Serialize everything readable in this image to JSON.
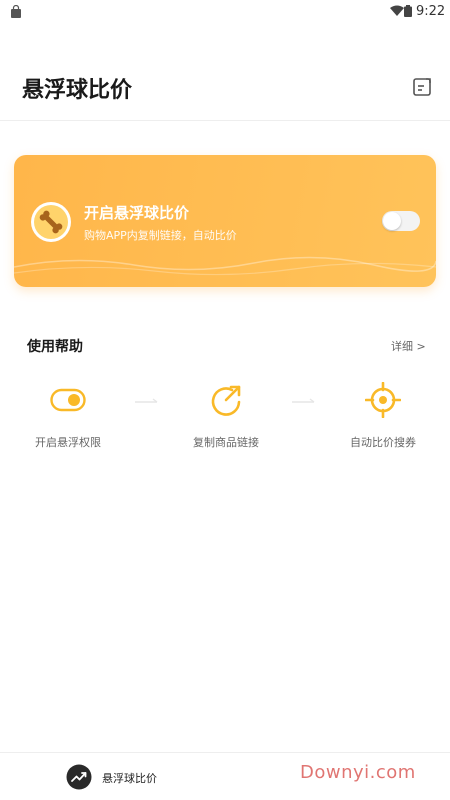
{
  "status_bar": {
    "time": "9:22"
  },
  "header": {
    "title": "悬浮球比价",
    "edit_icon": "edit-note-icon"
  },
  "promo_card": {
    "title": "开启悬浮球比价",
    "subtitle": "购物APP内复制链接，自动比价",
    "toggle_on": false,
    "gradient": [
      "#ffb64a",
      "#ffc35a"
    ]
  },
  "help": {
    "title": "使用帮助",
    "detail_link": "详细 >",
    "steps": [
      {
        "label": "开启悬浮权限",
        "icon": "toggle-icon"
      },
      {
        "label": "复制商品链接",
        "icon": "share-arrow-icon"
      },
      {
        "label": "自动比价搜券",
        "icon": "target-icon"
      }
    ]
  },
  "bottom_nav": {
    "items": [
      {
        "label": "悬浮球比价",
        "icon": "trend-icon"
      }
    ]
  },
  "watermark": {
    "text": "Downyi.com"
  },
  "colors": {
    "accent": "#f9b928",
    "text_primary": "#1a1a1a",
    "text_secondary": "#666666"
  }
}
